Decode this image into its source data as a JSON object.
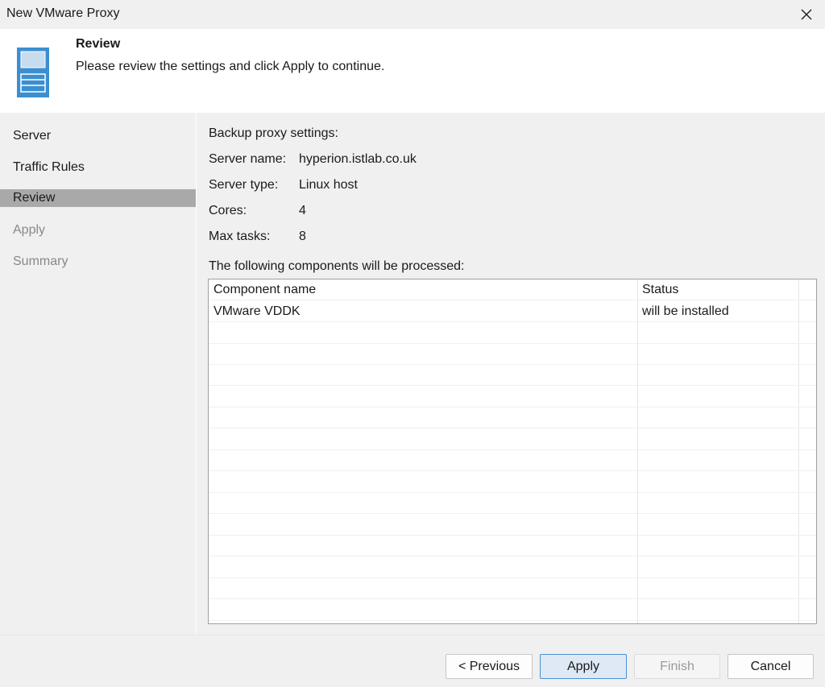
{
  "window": {
    "title": "New VMware Proxy"
  },
  "header": {
    "title": "Review",
    "description": "Please review the settings and click Apply to continue."
  },
  "sidebar": {
    "items": [
      {
        "label": "Server",
        "state": "normal"
      },
      {
        "label": "Traffic Rules",
        "state": "normal"
      },
      {
        "label": "Review",
        "state": "active"
      },
      {
        "label": "Apply",
        "state": "disabled"
      },
      {
        "label": "Summary",
        "state": "disabled"
      }
    ]
  },
  "settings": {
    "heading": "Backup proxy settings:",
    "fields": [
      {
        "label": "Server name:",
        "value": "hyperion.istlab.co.uk"
      },
      {
        "label": "Server type:",
        "value": "Linux host"
      },
      {
        "label": "Cores:",
        "value": "4"
      },
      {
        "label": "Max tasks:",
        "value": "8"
      }
    ]
  },
  "components": {
    "heading": "The following components will be processed:",
    "columns": [
      "Component name",
      "Status"
    ],
    "rows": [
      [
        "VMware VDDK",
        "will be installed"
      ]
    ]
  },
  "footer": {
    "previous_label": "< Previous",
    "apply_label": "Apply",
    "finish_label": "Finish",
    "cancel_label": "Cancel"
  },
  "colors": {
    "icon_blue": "#3b8fd1",
    "active_step": "#a9a9a9",
    "primary_button_border": "#4c8fd6"
  }
}
